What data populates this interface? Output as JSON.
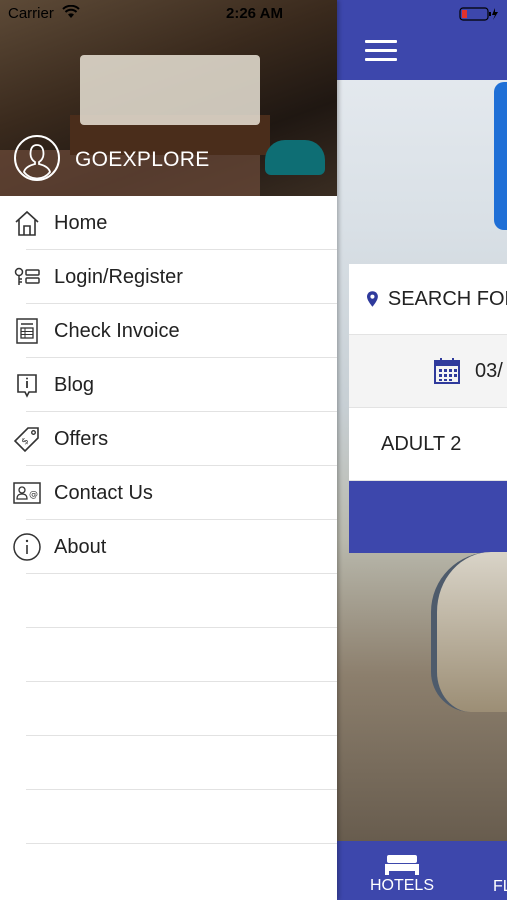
{
  "status_bar": {
    "carrier": "Carrier",
    "time": "2:26 AM"
  },
  "drawer": {
    "brand": "GOEXPLORE",
    "items": [
      {
        "label": "Home",
        "icon": "home-icon"
      },
      {
        "label": "Login/Register",
        "icon": "key-list-icon"
      },
      {
        "label": "Check Invoice",
        "icon": "invoice-icon"
      },
      {
        "label": "Blog",
        "icon": "blog-icon"
      },
      {
        "label": "Offers",
        "icon": "tag-icon"
      },
      {
        "label": "Contact Us",
        "icon": "contact-card-icon"
      },
      {
        "label": "About",
        "icon": "info-icon"
      }
    ]
  },
  "app": {
    "search_placeholder": "SEARCH FOR",
    "date": "03/",
    "adults": "ADULT 2",
    "tabs": [
      {
        "label": "HOTELS"
      },
      {
        "label": "FL"
      }
    ]
  },
  "colors": {
    "primary": "#3d47ac",
    "accent_blue": "#1f6fd6",
    "pin": "#2f3a9c"
  }
}
